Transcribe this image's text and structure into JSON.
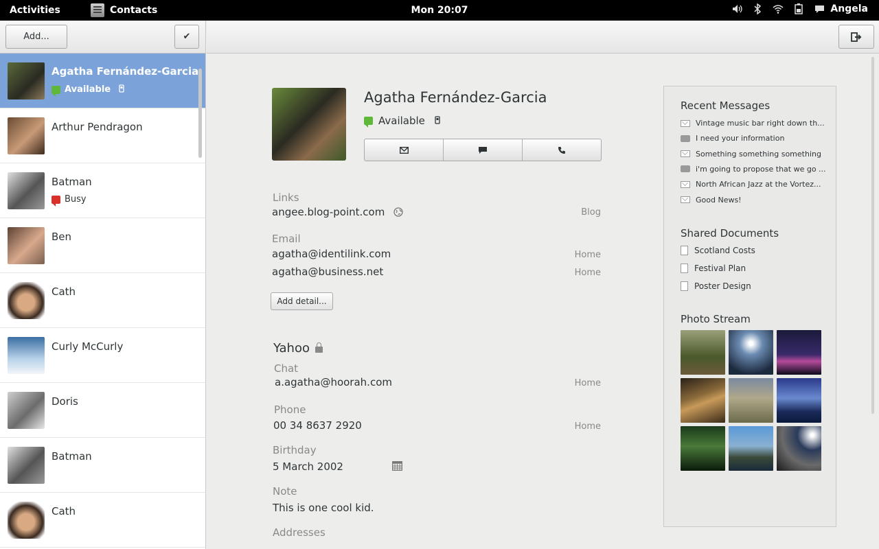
{
  "topbar": {
    "activities": "Activities",
    "app_name": "Contacts",
    "clock": "Mon 20:07",
    "user": "Angela",
    "icons": [
      "volume-icon",
      "bluetooth-icon",
      "wifi-icon",
      "battery-icon",
      "chat-icon"
    ]
  },
  "toolbar": {
    "add_label": "Add...",
    "done_glyph": "✔",
    "signout_glyph": "⇥"
  },
  "contacts": [
    {
      "name": "Agatha Fernández-Garcia",
      "status": "Available",
      "status_color": "green",
      "phone": true,
      "selected": true,
      "avatar": "linear-gradient(135deg,#5a6b3a,#2a2a22 60%,#8a7a5a)"
    },
    {
      "name": "Arthur Pendragon",
      "avatar": "linear-gradient(135deg,#6b4b33,#c89a77 55%,#3d2a1d)"
    },
    {
      "name": "Batman",
      "status": "Busy",
      "status_color": "red",
      "avatar": "linear-gradient(135deg,#e0e0e0,#555 55%,#999)"
    },
    {
      "name": "Ben",
      "avatar": "linear-gradient(135deg,#5c4233,#d8a98d 55%,#7a5e4d)"
    },
    {
      "name": "Cath",
      "avatar": "radial-gradient(circle at 50% 55%,#d8a982 30%,#3a2a20 60%,#fff 80%)"
    },
    {
      "name": "Curly McCurly",
      "avatar": "linear-gradient(180deg,#3b6ea3,#b9d3ea 60%,#f2f5f8)"
    },
    {
      "name": "Doris",
      "avatar": "linear-gradient(135deg,#cfcfcf,#6b6b6b 55%,#e8e8e8)"
    },
    {
      "name": "Batman",
      "avatar": "linear-gradient(135deg,#e0e0e0,#555 55%,#999)"
    },
    {
      "name": "Cath",
      "avatar": "radial-gradient(circle at 50% 55%,#d8a982 30%,#3a2a20 60%,#fff 80%)"
    }
  ],
  "detail": {
    "name": "Agatha Fernández-Garcia",
    "status": "Available",
    "avatar": "linear-gradient(135deg,#6a8a3a,#2b2b22 45%,#8a6a4a 70%,#3e5a2a)",
    "actions": {
      "email_glyph": "✉",
      "chat_glyph": "💬",
      "call_glyph": "✆"
    },
    "links_label": "Links",
    "link_value": "angee.blog-point.com",
    "link_type": "Blog",
    "email_label": "Email",
    "emails": [
      {
        "value": "agatha@identilink.com",
        "type": "Home"
      },
      {
        "value": "agatha@business.net",
        "type": "Home"
      }
    ],
    "add_detail": "Add detail...",
    "account": "Yahoo",
    "chat_label": "Chat",
    "chat_value": "a.agatha@hoorah.com",
    "chat_type": "Home",
    "phone_label": "Phone",
    "phone_value": "00 34 8637 2920",
    "phone_type": "Home",
    "birthday_label": "Birthday",
    "birthday_value": "5 March 2002",
    "note_label": "Note",
    "note_value": "This is one cool kid.",
    "addresses_label": "Addresses"
  },
  "sidebar": {
    "recent_title": "Recent Messages",
    "messages": [
      {
        "kind": "email",
        "text": "Vintage music bar right down th..."
      },
      {
        "kind": "chat",
        "text": "I need your information"
      },
      {
        "kind": "email",
        "text": "Something something something"
      },
      {
        "kind": "chat",
        "text": "i'm going to propose that we go ..."
      },
      {
        "kind": "email",
        "text": "North African Jazz at the Vortez..."
      },
      {
        "kind": "email",
        "text": "Good News!"
      }
    ],
    "docs_title": "Shared Documents",
    "documents": [
      "Scotland Costs",
      "Festival Plan",
      "Poster Design"
    ],
    "photos_title": "Photo Stream",
    "photos": [
      "linear-gradient(180deg,#9aa07a,#4a5a2a 60%,#6b5a3a)",
      "radial-gradient(circle at 50% 30%,#ffffff 5%,#6a8ab0 30%,#1c2a3e 80%)",
      "linear-gradient(180deg,#1a1a3a,#3a2a6a 55%,#b44a9a 70%,#0a0a1a)",
      "linear-gradient(160deg,#2a2018,#8a6a3a 40%,#c89a5a 55%,#3a2a18)",
      "linear-gradient(180deg,#7a8aa0,#b0a88a 45%,#6a6a4a)",
      "linear-gradient(180deg,#2a3a8a,#6a8ad0 45%,#1a2a5a 75%,#0a1a3a)",
      "linear-gradient(180deg,#1a3a1a,#4a7a3a 45%,#0a1a0a)",
      "linear-gradient(180deg,#5a9ad8,#8ab0d0 45%,#3a4a3a 70%,#1a2a3a)",
      "radial-gradient(circle at 80% 20%,#ffffff 3%,#2a3a5a 30%,#6a6a6a 60%,#1a1a1a)"
    ]
  }
}
